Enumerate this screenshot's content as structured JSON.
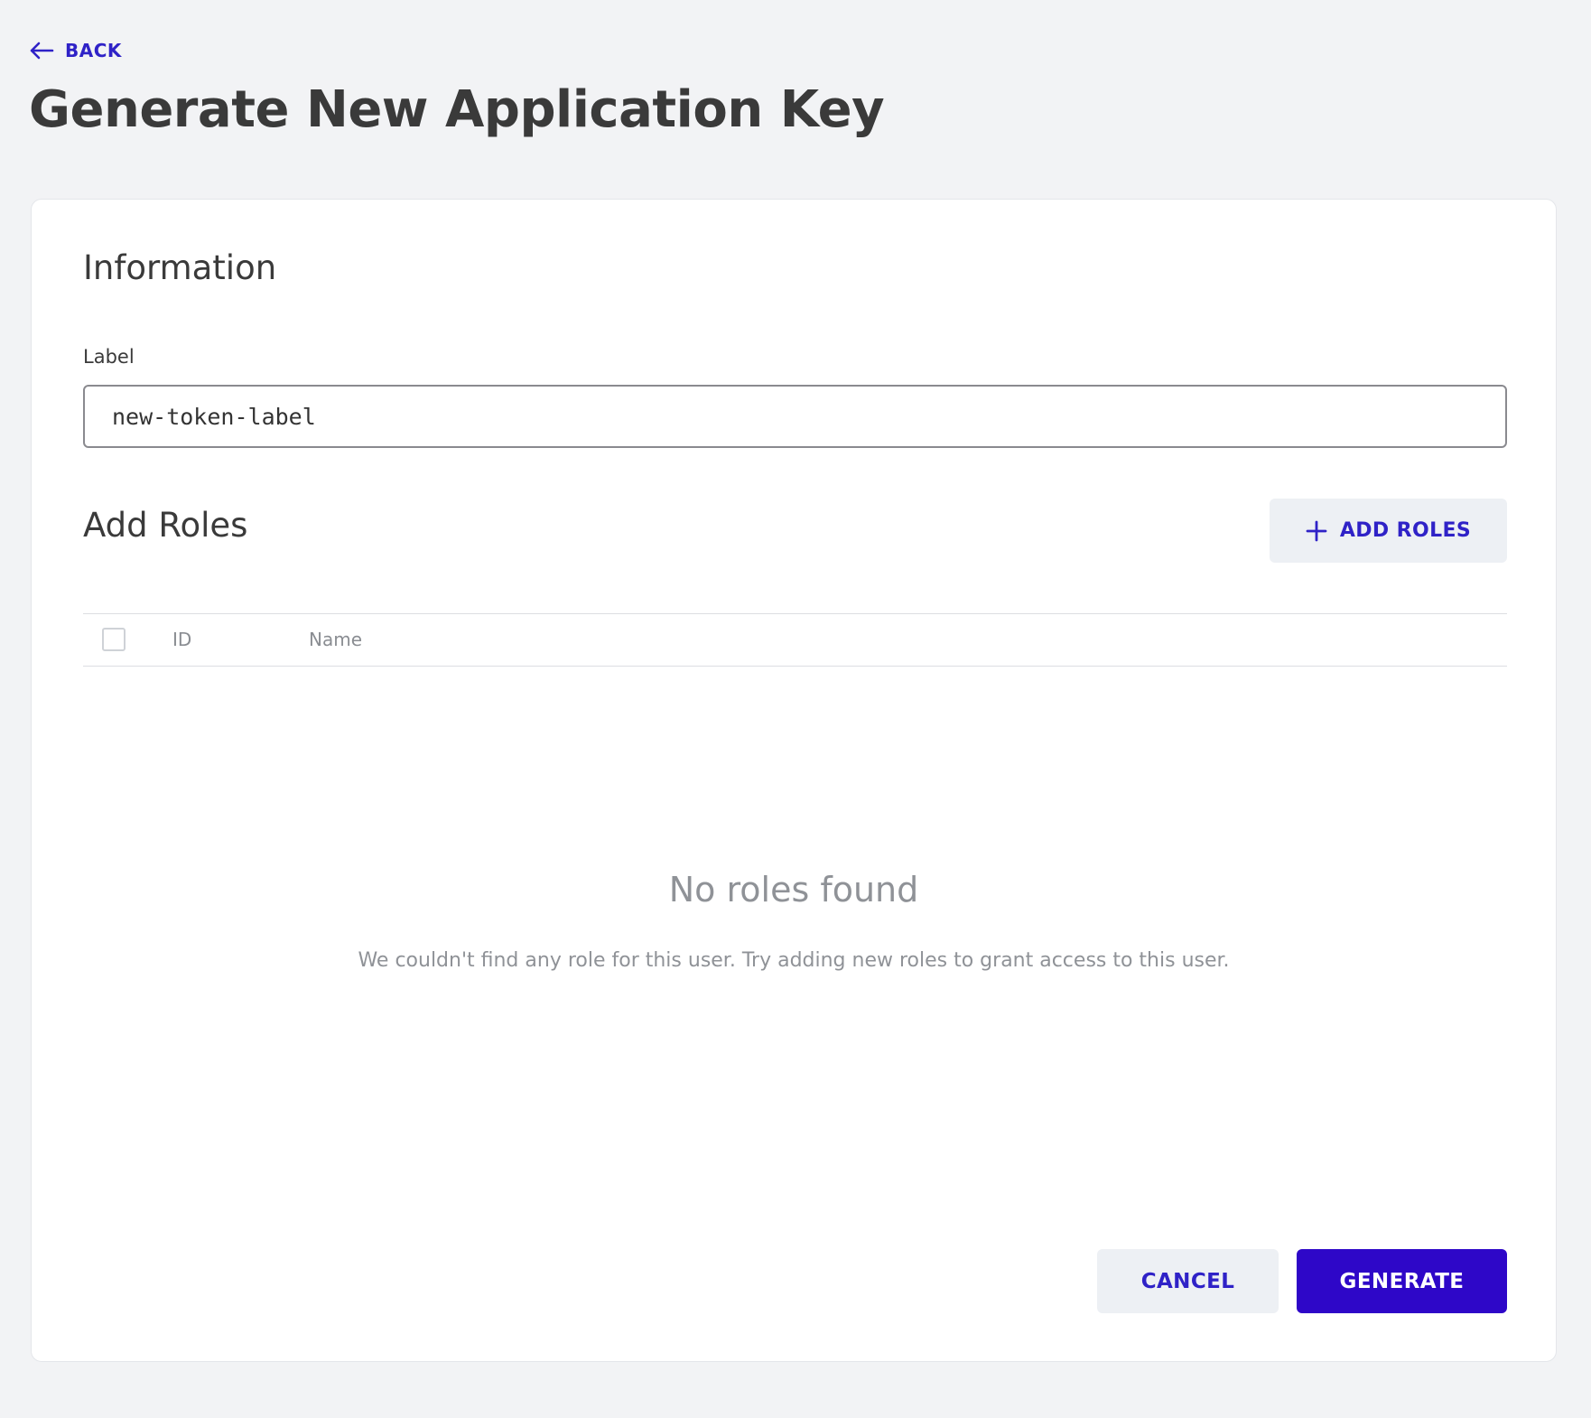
{
  "header": {
    "back_label": "BACK",
    "back_icon": "arrow-left-icon",
    "title": "Generate New Application Key"
  },
  "information": {
    "title": "Information",
    "label_field": {
      "label": "Label",
      "value": "new-token-label"
    }
  },
  "roles": {
    "title": "Add Roles",
    "add_button_label": "ADD ROLES",
    "add_button_icon": "plus-icon",
    "columns": [
      "ID",
      "Name"
    ],
    "rows": [],
    "empty_state": {
      "title": "No roles found",
      "description": "We couldn't find any role for this user. Try adding new roles to grant access to this user."
    }
  },
  "actions": {
    "cancel_label": "CANCEL",
    "generate_label": "GENERATE"
  },
  "colors": {
    "accent": "#2f22c7",
    "primary_button": "#2e07c8",
    "page_background": "#f2f3f5",
    "secondary_button": "#edf0f4"
  }
}
